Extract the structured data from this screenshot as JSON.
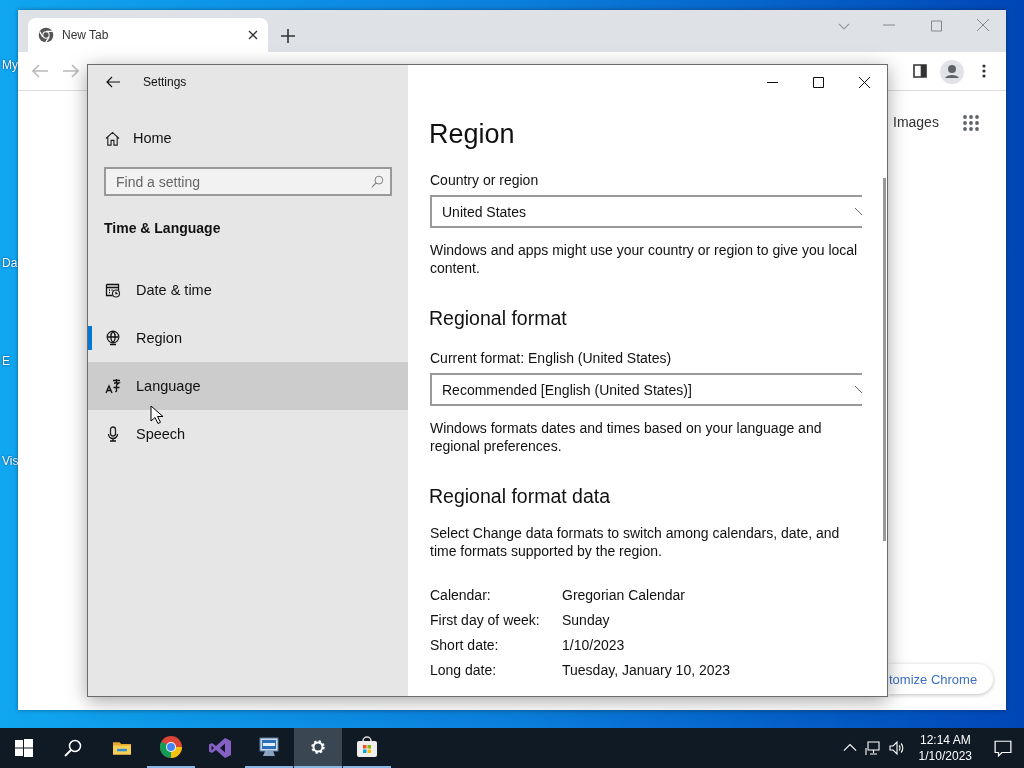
{
  "desktop": {
    "icons": [
      {
        "label": "My"
      },
      {
        "label": "Da"
      },
      {
        "label": "E"
      },
      {
        "label": "Vis"
      }
    ]
  },
  "browser": {
    "tab": {
      "title": "New Tab",
      "selected": true
    },
    "links": [
      "Images"
    ],
    "customize_button": "tomize Chrome"
  },
  "settings": {
    "window": {
      "title": "Settings"
    },
    "home": "Home",
    "search": {
      "placeholder": "Find a setting"
    },
    "section": "Time & Language",
    "nav": [
      {
        "kind": "datetime",
        "label": "Date & time",
        "selected": false,
        "hovered": false
      },
      {
        "kind": "region",
        "label": "Region",
        "selected": true,
        "hovered": false
      },
      {
        "kind": "language",
        "label": "Language",
        "selected": false,
        "hovered": true
      },
      {
        "kind": "speech",
        "label": "Speech",
        "selected": false,
        "hovered": false
      }
    ],
    "page": {
      "title": "Region",
      "country_label": "Country or region",
      "country_value": "United States",
      "country_note": "Windows and apps might use your country or region to give you local content.",
      "format_heading": "Regional format",
      "format_label": "Current format: English (United States)",
      "format_value": "Recommended [English (United States)]",
      "format_note": "Windows formats dates and times based on your language and regional preferences.",
      "data_heading": "Regional format data",
      "data_note": "Select Change data formats to switch among calendars, date, and time formats supported by the region.",
      "data_rows": [
        {
          "label": "Calendar:",
          "value": "Gregorian Calendar"
        },
        {
          "label": "First day of week:",
          "value": "Sunday"
        },
        {
          "label": "Short date:",
          "value": "1/10/2023"
        },
        {
          "label": "Long date:",
          "value": "Tuesday, January 10, 2023"
        }
      ]
    }
  },
  "taskbar": {
    "apps": [
      {
        "kind": "start",
        "running": false,
        "active": false
      },
      {
        "kind": "search",
        "running": false,
        "active": false
      },
      {
        "kind": "explorer",
        "running": false,
        "active": false
      },
      {
        "kind": "chrome",
        "running": true,
        "active": false
      },
      {
        "kind": "studio",
        "running": false,
        "active": false
      },
      {
        "kind": "remote",
        "running": true,
        "active": false
      },
      {
        "kind": "settings",
        "running": true,
        "active": true
      },
      {
        "kind": "store",
        "running": true,
        "active": false
      }
    ],
    "clock": {
      "time": "12:14 AM",
      "date": "1/10/2023"
    }
  }
}
